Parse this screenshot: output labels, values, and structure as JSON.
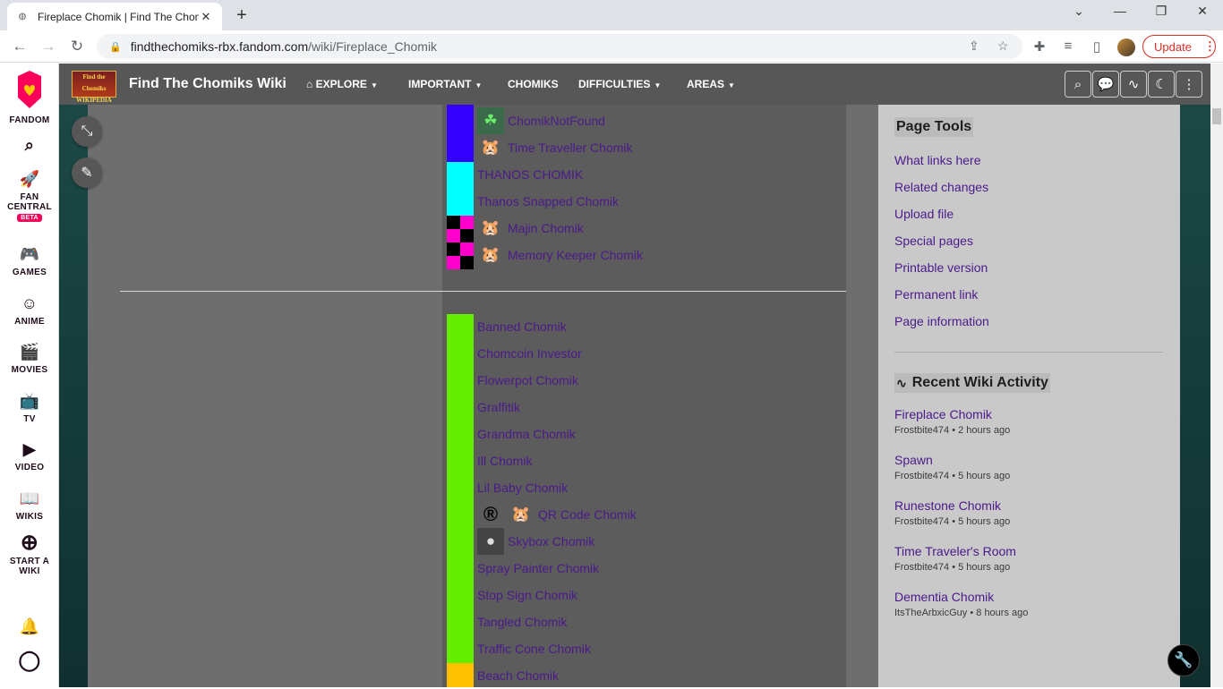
{
  "browser": {
    "tab_title": "Fireplace Chomik | Find The Chomiks Wiki",
    "url_host": "findthechomiks-rbx.fandom.com",
    "url_path": "/wiki/Fireplace_Chomik",
    "update_label": "Update"
  },
  "rail": {
    "fandom": "FANDOM",
    "fan_central_1": "FAN",
    "fan_central_2": "CENTRAL",
    "beta": "BETA",
    "games": "GAMES",
    "anime": "ANIME",
    "movies": "MOVIES",
    "tv": "TV",
    "video": "VIDEO",
    "wikis": "WIKIS",
    "start_1": "START A",
    "start_2": "WIKI"
  },
  "wiki": {
    "logo_1": "Find the Chomiks",
    "logo_2": "WIKIPEDIA",
    "name": "Find The Chomiks Wiki",
    "nav": [
      "EXPLORE",
      "IMPORTANT",
      "CHOMIKS",
      "DIFFICULTIES",
      "AREAS"
    ]
  },
  "table_top": [
    {
      "label": "ChomikNotFound",
      "icon": "clover"
    },
    {
      "label": "Time Traveller Chomik",
      "icon": "chomik"
    },
    {
      "label": "THANOS CHOMIK",
      "icon": ""
    },
    {
      "label": "Thanos Snapped Chomik",
      "icon": ""
    },
    {
      "label": "Majin Chomik",
      "icon": "chomik-blue"
    },
    {
      "label": "Memory Keeper Chomik",
      "icon": "chomik"
    }
  ],
  "table_bottom": [
    {
      "label": "Banned Chomik"
    },
    {
      "label": "Chomcoin Investor"
    },
    {
      "label": "Flowerpot Chomik"
    },
    {
      "label": "Graffitik"
    },
    {
      "label": "Grandma Chomik"
    },
    {
      "label": "Ill Chomik"
    },
    {
      "label": "Lil Baby Chomik"
    },
    {
      "label": "QR Code Chomik"
    },
    {
      "label": "Skybox Chomik"
    },
    {
      "label": "Spray Painter Chomik"
    },
    {
      "label": "Stop Sign Chomik"
    },
    {
      "label": "Tangled Chomik"
    },
    {
      "label": "Traffic Cone Chomik"
    },
    {
      "label": "Beach Chomik"
    }
  ],
  "colors": {
    "blue": "#3300ff",
    "cyan": "#00ffff",
    "magenta": "#ff00cc",
    "green": "#66ee00",
    "yellow": "#ffc000"
  },
  "page_tools": {
    "title": "Page Tools",
    "links": [
      "What links here",
      "Related changes",
      "Upload file",
      "Special pages",
      "Printable version",
      "Permanent link",
      "Page information"
    ]
  },
  "recent": {
    "title": "Recent Wiki Activity",
    "items": [
      {
        "title": "Fireplace Chomik",
        "meta": "Frostbite474 • 2 hours ago"
      },
      {
        "title": "Spawn",
        "meta": "Frostbite474 • 5 hours ago"
      },
      {
        "title": "Runestone Chomik",
        "meta": "Frostbite474 • 5 hours ago"
      },
      {
        "title": "Time Traveler's Room",
        "meta": "Frostbite474 • 5 hours ago"
      },
      {
        "title": "Dementia Chomik",
        "meta": "ItsTheArbxicGuy • 8 hours ago"
      }
    ]
  }
}
